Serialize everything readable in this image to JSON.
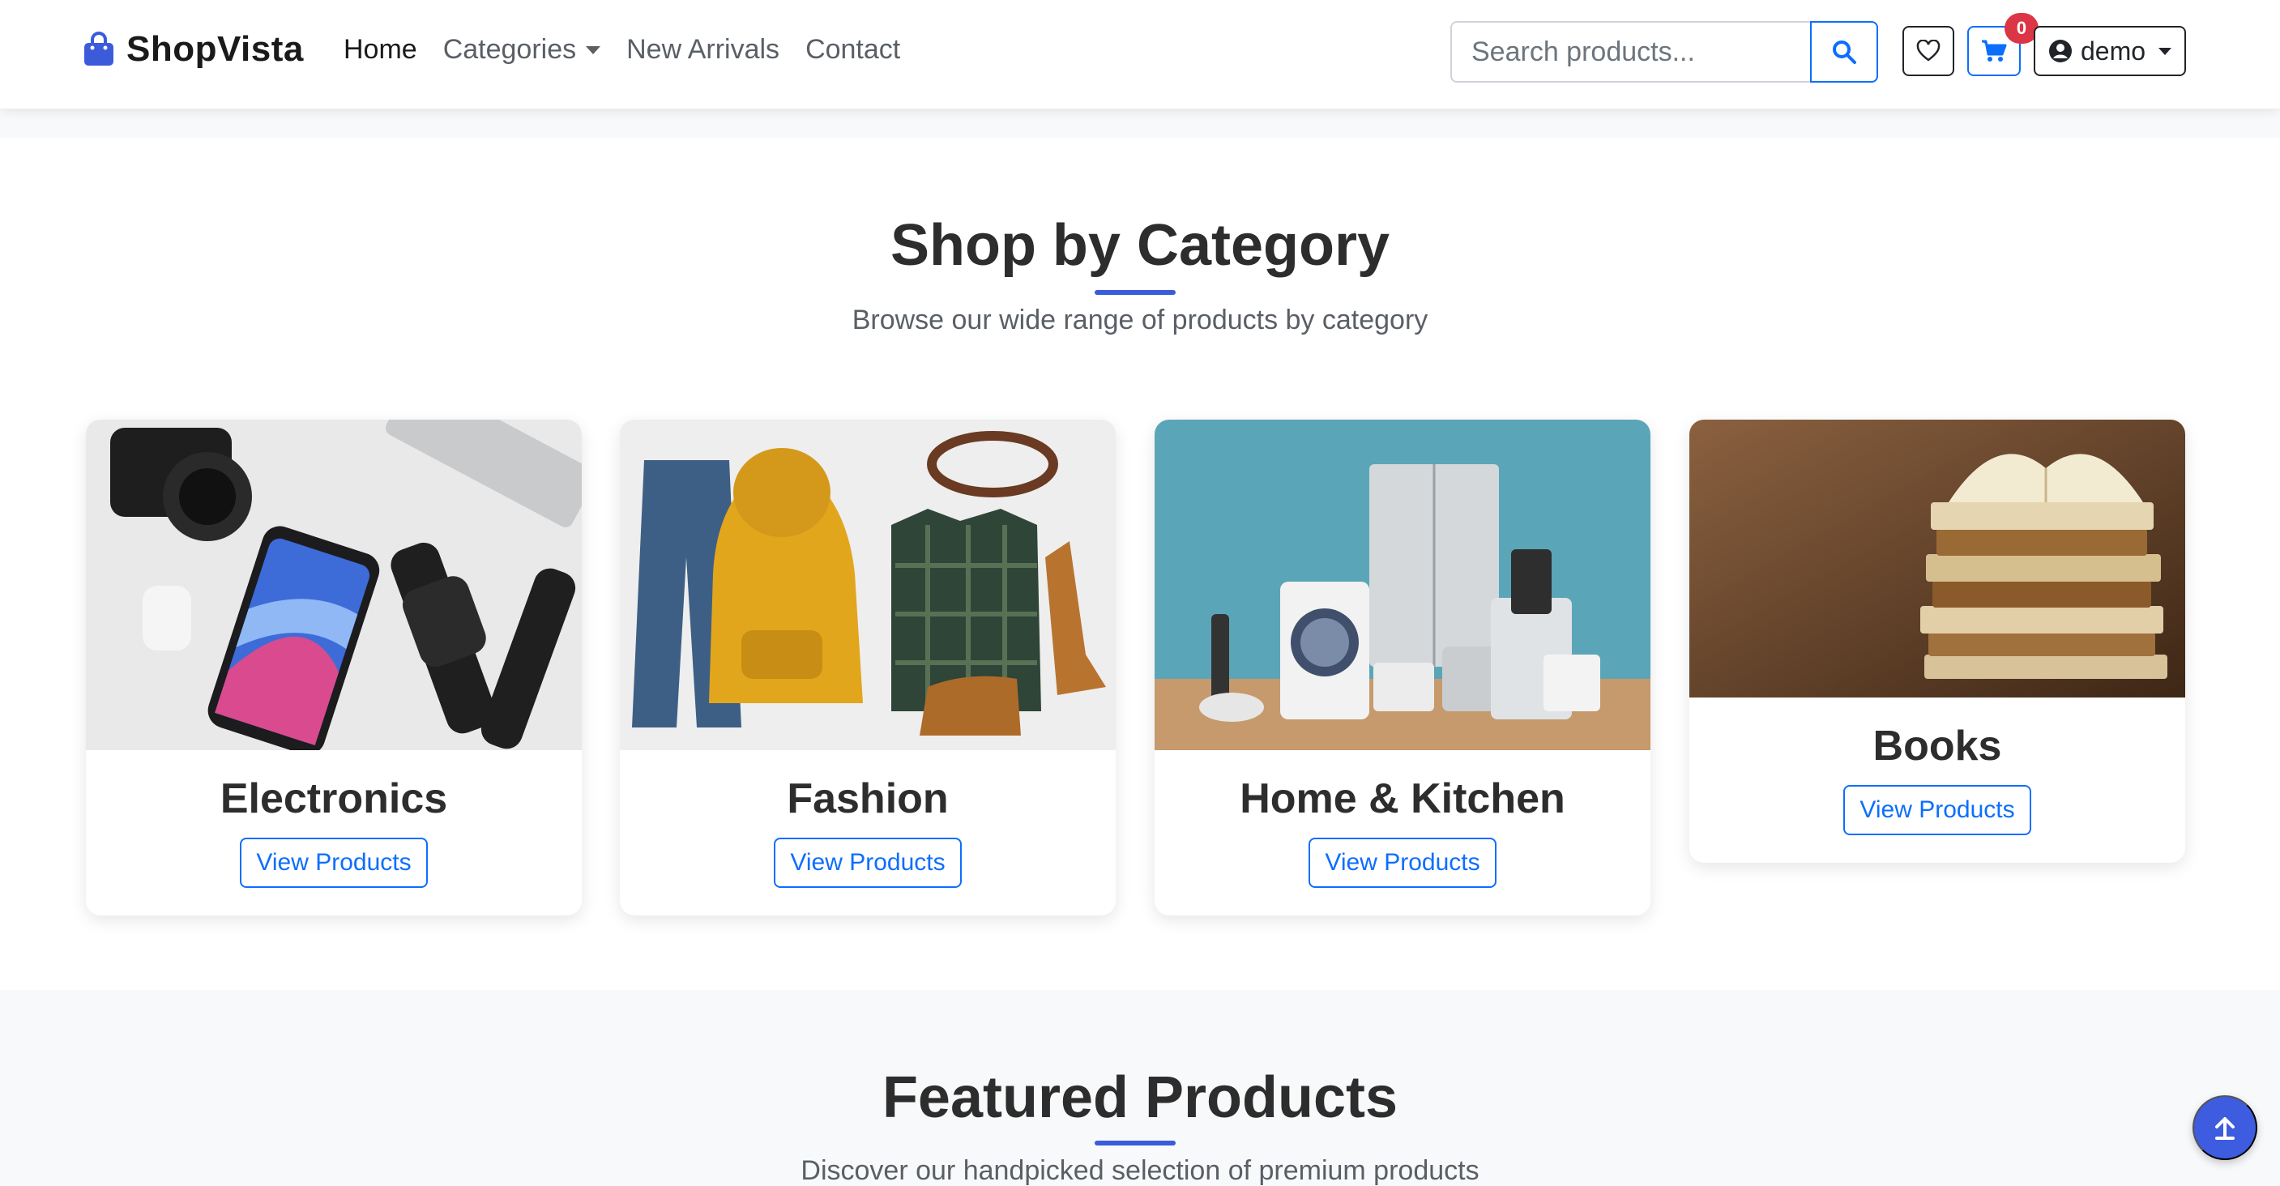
{
  "navbar": {
    "brand": "ShopVista",
    "links": [
      {
        "label": "Home",
        "active": true
      },
      {
        "label": "Categories",
        "dropdown": true
      },
      {
        "label": "New Arrivals"
      },
      {
        "label": "Contact"
      }
    ],
    "search_placeholder": "Search products...",
    "cart_count": "0",
    "user_label": "demo",
    "icons": [
      "bag-icon",
      "search-icon",
      "heart-icon",
      "cart-icon",
      "user-circle-icon"
    ]
  },
  "categories_section": {
    "title": "Shop by Category",
    "subtitle": "Browse our wide range of products by category",
    "cards": [
      {
        "name": "Electronics",
        "button": "View Products"
      },
      {
        "name": "Fashion",
        "button": "View Products"
      },
      {
        "name": "Home & Kitchen",
        "button": "View Products"
      },
      {
        "name": "Books",
        "button": "View Products"
      }
    ]
  },
  "featured_section": {
    "title": "Featured Products",
    "subtitle": "Discover our handpicked selection of premium products"
  },
  "colors": {
    "accent": "#0d6efd",
    "brand": "#3b5bdb",
    "badge": "#dc3545"
  }
}
